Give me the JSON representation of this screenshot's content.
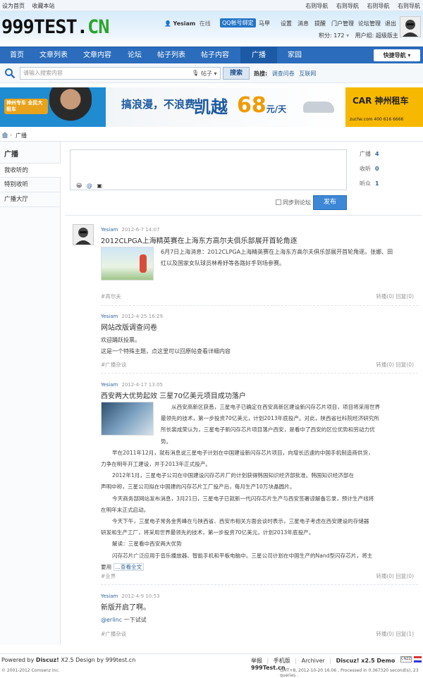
{
  "topbar": {
    "left": [
      "设为首页",
      "收藏本站"
    ],
    "right": [
      "右则导航",
      "右则导航",
      "右则导航",
      "右则导航"
    ]
  },
  "header": {
    "logo_main": "999TEST.",
    "logo_cn": "CN",
    "username": "Yesiam",
    "online": "在线",
    "qq_bind": "QQ帐号绑定",
    "links": [
      "马甲",
      "设置",
      "消息",
      "提醒",
      "门户管理",
      "论坛管理",
      "退出"
    ],
    "credits": "积分: 172",
    "usergroup": "用户组: 超级版主"
  },
  "nav": {
    "items": [
      "首页",
      "文章列表",
      "文章内容",
      "论坛",
      "帖子列表",
      "帖子内容",
      "广播",
      "家园"
    ],
    "active": "广播",
    "quick_nav": "快捷导航"
  },
  "search": {
    "placeholder": "请输入搜索内容",
    "type": "帖子",
    "button": "搜索",
    "hot_label": "热搜:",
    "hot_items": [
      "调查问卷",
      "互联网"
    ]
  },
  "banner": {
    "pill": "神州专车 全民大租车",
    "slogan": "搞浪漫，不浪费",
    "model": "凯越",
    "price": "68",
    "unit": "元/天",
    "brand": "CAR 神州租车",
    "site": "zuche.com 400 616 6666"
  },
  "breadcrumb": {
    "current": "广播"
  },
  "sidebar": {
    "title": "广播",
    "items": [
      "我收听的",
      "特别收听",
      "广播大厅"
    ],
    "active": "我收听的"
  },
  "compose": {
    "sync_label": "同步到论坛",
    "publish": "发布"
  },
  "stats": [
    {
      "label": "广播",
      "value": "4"
    },
    {
      "label": "收听",
      "value": "0"
    },
    {
      "label": "听众",
      "value": "1"
    }
  ],
  "posts": [
    {
      "user": "Yesiam",
      "time": "2012-6-7 14:07",
      "title": "2012CLPGA上海精英赛在上海东方高尔夫俱乐部展开首轮角逐",
      "body": [
        "6月7日上海消息：2012CLPGA上海精英赛在上海东方高尔夫俱乐部展开首轮角逐。张娜、田",
        "红以及国家女队球员林希妤等各路好手到场参赛。"
      ],
      "tag": "#高尔夫",
      "repost": "转播(0)",
      "reply": "回复(0)"
    },
    {
      "user": "Yesiam",
      "time": "2012-4-25 16:29",
      "title": "网站改版调查问卷",
      "body": [
        "欢迎踊跃投票。",
        "这是一个特殊主题，点这里可以回原帖查看详细内容"
      ],
      "tag": "#广播杂谈",
      "repost": "转播(0)",
      "reply": "回复(0)"
    },
    {
      "user": "Yesiam",
      "time": "2012-4-17 13:05",
      "title": "西安两大优势起效 三星70亿美元项目成功落户",
      "body": [
        "从西安高新区获悉，三星电子已确定在西安高新区建设新闪存芯片项目，项目将采用世界",
        "最领先的技术，第一步投资70亿美元，计划2013年底投产。对此，陕西省社科院经济研究所",
        "所长裴成荣认为，三星电子新闪存芯片项目落户西安，是看中了西安的区位优势和劳动力优",
        "势。",
        "早在2011年12月，就有消息说三星电子计划在中国建设新闪存芯片项目，向增长迅速的中国手机制造商供货，",
        "力争在明年开工建设，并于2013年正式投产。",
        "2012年1月，三星电子公司在中国建设闪存芯片厂的计划获得韩国知识经济部批准。韩国知识经济部在",
        "声明中称，三星公司拟在中国建的闪存芯片工厂投产后，每月生产10万块晶圆片。",
        "今天商务部网站发布消息，3月21日，三星电子已就新一代闪存芯片生产与西安签署谅解备忘录，预计生产线将",
        "在明年末正式启动。",
        "今天下午，三星电子常务金秀峰在与陕西省、西安市相关方面会谈时表示，三星电子考虑在西安建设的存储器",
        "研发和生产工厂，将采用世界最领先的技术，第一步投资70亿美元，计划2013年底投产。",
        "解读：三星看中西安两大优势",
        "闪存芯片广泛应用于音乐播放器、智能手机和平板电脑中。三星公司计划在中国生产的Nand型闪存芯片，将主",
        "要用"
      ],
      "more": "...查看全文",
      "tag": "#业界",
      "repost": "转播(0)",
      "reply": "回复(0)"
    },
    {
      "user": "Yesiam",
      "time": "2012-4-9 10:53",
      "title": "新版开启了啊。",
      "mention": "@erlinc",
      "body_after": " 一下试试",
      "tag": "#广播杂谈",
      "repost": "转播(0)",
      "reply": "回复(1)"
    }
  ],
  "footer": {
    "powered": "Powered by",
    "powered_name": "Discuz!",
    "powered_rest": " X2.5 Design by 999test.cn",
    "copyright": "© 2001-2012 Comsenz Inc.",
    "links": [
      "举报",
      "|",
      "手机版",
      "|",
      "Archiver",
      "|",
      "Discuz! x2.5 Demo 999Test.cn"
    ],
    "gmt": "GMT+8, 2012-10-20 16:06 , Processed in 0.367320 second(s), 23 queries .",
    "badge": "CNZZ"
  }
}
